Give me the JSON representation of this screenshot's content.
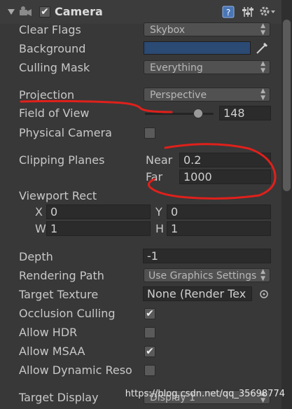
{
  "header": {
    "title": "Camera",
    "enabled": true
  },
  "fields": {
    "clear_flags": {
      "label": "Clear Flags",
      "value": "Skybox"
    },
    "background": {
      "label": "Background",
      "color": "#2b4a74"
    },
    "culling_mask": {
      "label": "Culling Mask",
      "value": "Everything"
    },
    "projection": {
      "label": "Projection",
      "value": "Perspective"
    },
    "field_of_view": {
      "label": "Field of View",
      "value": "148"
    },
    "physical_camera": {
      "label": "Physical Camera",
      "checked": false
    },
    "clipping_planes": {
      "label": "Clipping Planes",
      "near_label": "Near",
      "near_value": "0.2",
      "far_label": "Far",
      "far_value": "1000"
    },
    "viewport_rect": {
      "label": "Viewport Rect",
      "x_label": "X",
      "x_value": "0",
      "y_label": "Y",
      "y_value": "0",
      "w_label": "W",
      "w_value": "1",
      "h_label": "H",
      "h_value": "1"
    },
    "depth": {
      "label": "Depth",
      "value": "-1"
    },
    "rendering_path": {
      "label": "Rendering Path",
      "value": "Use Graphics Settings"
    },
    "target_texture": {
      "label": "Target Texture",
      "value": "None (Render Tex"
    },
    "occlusion_culling": {
      "label": "Occlusion Culling",
      "checked": true
    },
    "allow_hdr": {
      "label": "Allow HDR",
      "checked": false
    },
    "allow_msaa": {
      "label": "Allow MSAA",
      "checked": true
    },
    "allow_dynamic_reso": {
      "label": "Allow Dynamic Reso",
      "checked": false
    },
    "target_display": {
      "label": "Target Display",
      "value": "Display 1"
    }
  },
  "watermark": "https://blog.csdn.net/qq_35698774",
  "colors": {
    "annotation": "#e0201b",
    "panel": "#383838"
  },
  "icons": [
    "expand-arrow-icon",
    "camera-icon",
    "help-icon",
    "presets-icon",
    "gear-icon",
    "eyedropper-icon",
    "object-picker-icon"
  ]
}
